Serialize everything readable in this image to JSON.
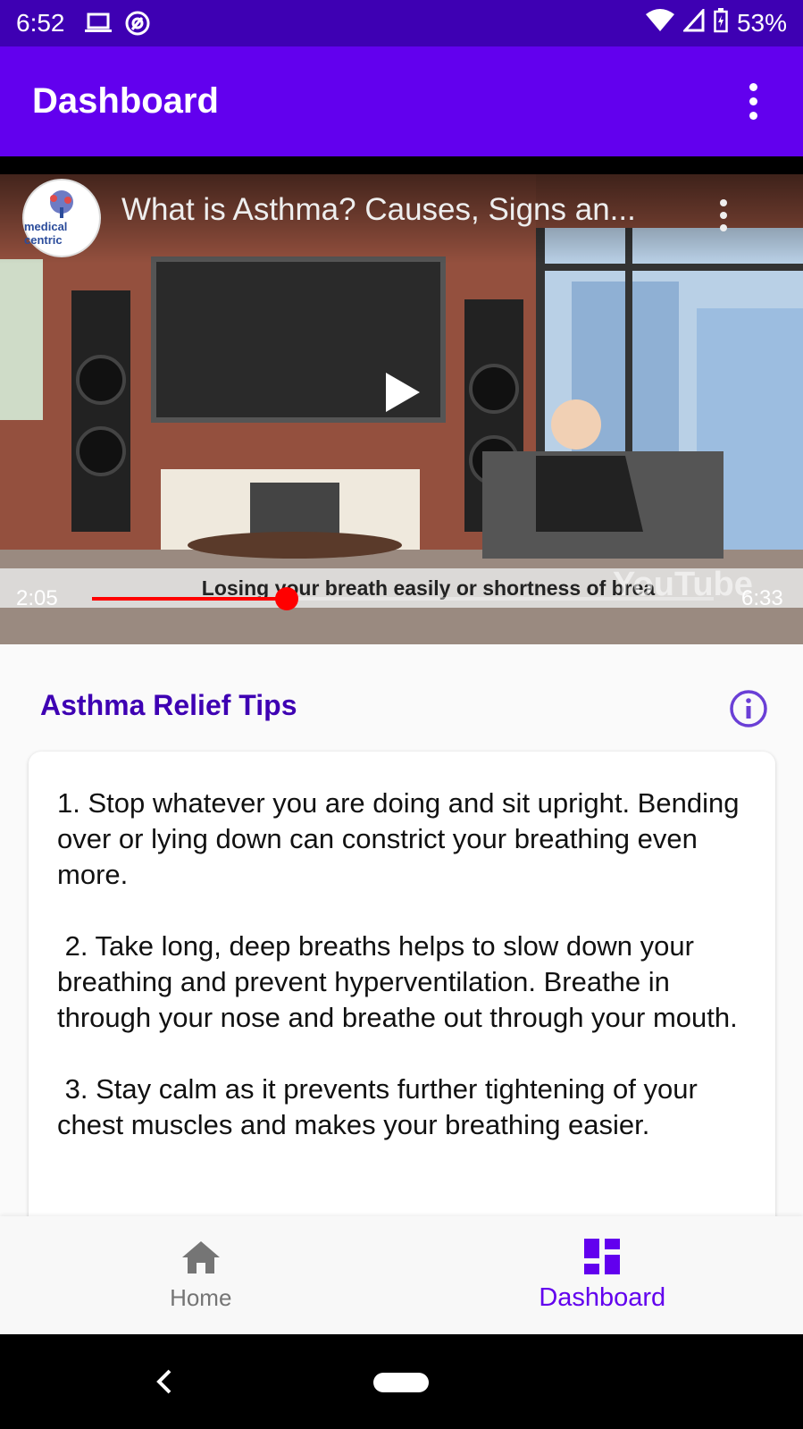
{
  "status_bar": {
    "time": "6:52",
    "battery": "53%"
  },
  "app_bar": {
    "title": "Dashboard"
  },
  "video": {
    "title": "What is Asthma? Causes, Signs an...",
    "channel_logo_text": "medical centric",
    "caption": "Losing your breath easily or shortness of brea",
    "current_time": "2:05",
    "duration": "6:33",
    "progress_fraction": 0.313,
    "yt_watermark": "YouTube"
  },
  "tips": {
    "header": "Asthma Relief Tips",
    "text": "1. Stop whatever you are doing and sit upright. Bending over or lying down can constrict your breathing even more.\n\n 2. Take long, deep breaths helps to slow down your breathing and prevent hyperventilation. Breathe in through your nose and breathe out through your mouth.\n\n 3. Stay calm as it prevents further tightening of your chest muscles and makes your breathing easier."
  },
  "bottom_nav": {
    "items": [
      {
        "label": "Home",
        "icon": "home-icon",
        "selected": false
      },
      {
        "label": "Dashboard",
        "icon": "dashboard-icon",
        "selected": true
      }
    ]
  },
  "colors": {
    "status_bar": "#3e00b3",
    "primary": "#6200ee",
    "accent_text": "#3e00b3",
    "progress": "#ff0000"
  }
}
